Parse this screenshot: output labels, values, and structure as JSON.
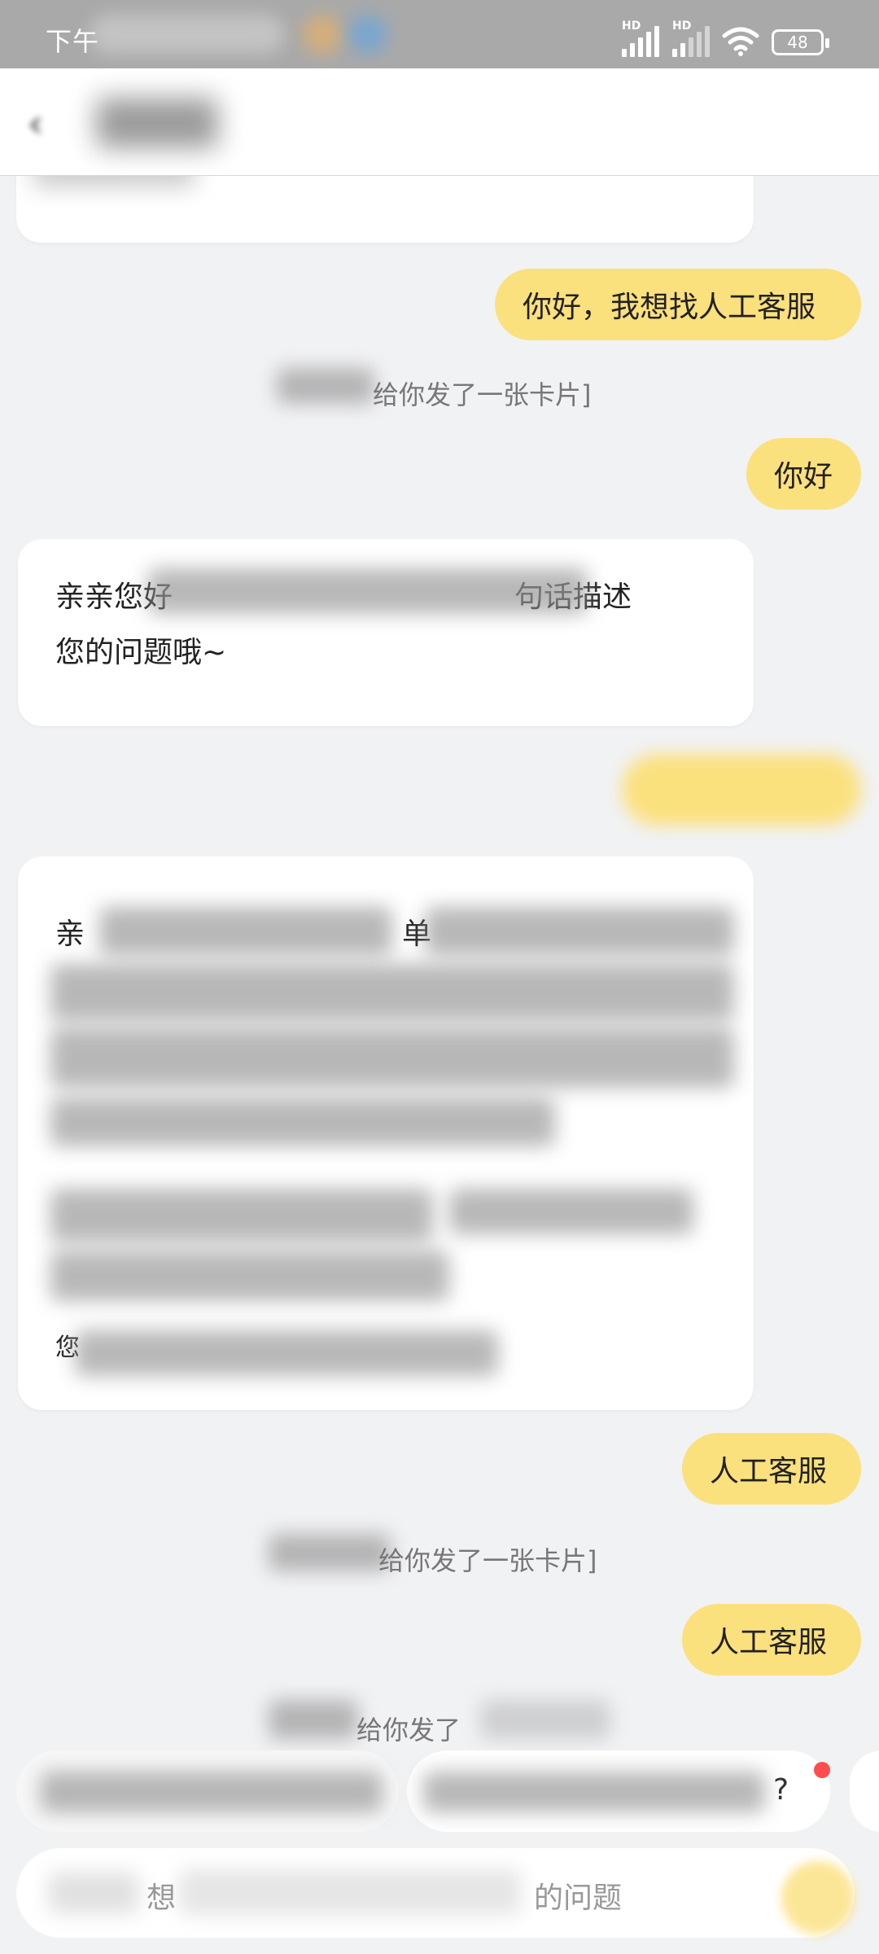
{
  "status_bar": {
    "time": "下午",
    "battery": "48",
    "signal1_label": "HD",
    "signal2_label": "HD"
  },
  "header": {
    "back_icon": "chevron-left-icon"
  },
  "messages": [
    {
      "type": "user",
      "text": "你好，我想找人工客服"
    },
    {
      "type": "system",
      "text": "给你发了一张卡片]"
    },
    {
      "type": "user",
      "text": "你好"
    },
    {
      "type": "bot",
      "line1_start": "亲亲您好",
      "line1_end": "句话描述",
      "line2": "您的问题哦~"
    },
    {
      "type": "user",
      "text": ""
    },
    {
      "type": "bot",
      "line1_start": "亲",
      "line1_mid": "单",
      "footer": "您"
    },
    {
      "type": "user",
      "text": "人工客服"
    },
    {
      "type": "system",
      "text": "给你发了一张卡片]"
    },
    {
      "type": "user",
      "text": "人工客服"
    },
    {
      "type": "system",
      "text": "给你发了"
    }
  ],
  "suggestion": {
    "text": "?"
  },
  "input": {
    "placeholder_start": "想",
    "placeholder_end": "的问题"
  },
  "colors": {
    "user_bubble": "#fbe07e",
    "background": "#f1f2f4",
    "status_bar": "#a9a9a9"
  }
}
